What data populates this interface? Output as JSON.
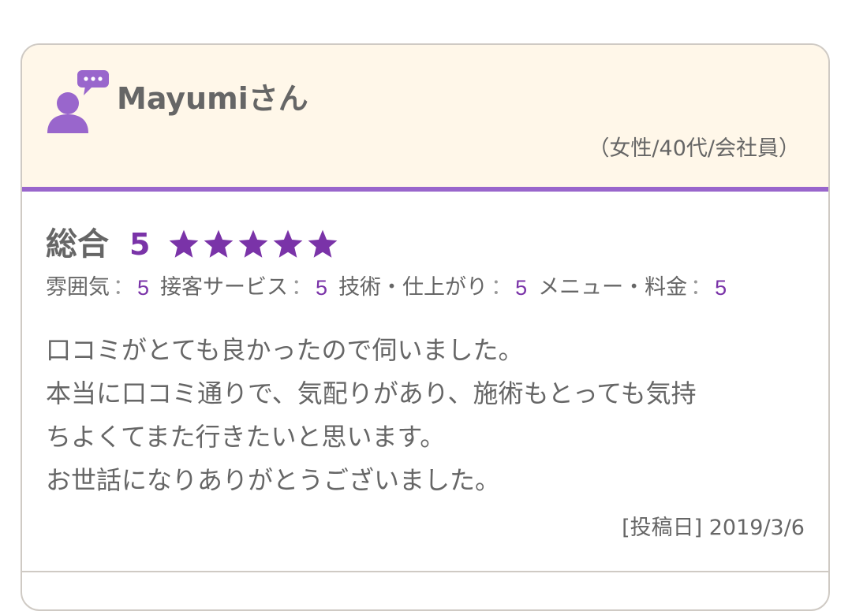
{
  "review": {
    "user_name": "Mayumiさん",
    "profile": "（女性/40代/会社員）",
    "overall_label": "総合",
    "overall_score": "5",
    "star_count": 5,
    "star_color": "#7a33a8",
    "accent_color": "#9966cc",
    "header_bg": "#fff7e9",
    "sub_ratings": [
      {
        "label": "雰囲気",
        "separator": "：",
        "value": "5"
      },
      {
        "label": "接客サービス",
        "separator": "：",
        "value": "5"
      },
      {
        "label": "技術・仕上がり",
        "separator": "：",
        "value": "5"
      },
      {
        "label": "メニュー・料金",
        "separator": "：",
        "value": "5"
      }
    ],
    "body_lines": [
      "口コミがとても良かったので伺いました。",
      "本当に口コミ通りで、気配りがあり、施術もとっても気持",
      "ちよくてまた行きたいと思います。",
      "お世話になりありがとうございました。"
    ],
    "post_date": "[投稿日] 2019/3/6",
    "icons": {
      "user": "user-chat-icon",
      "star": "star-icon"
    }
  }
}
